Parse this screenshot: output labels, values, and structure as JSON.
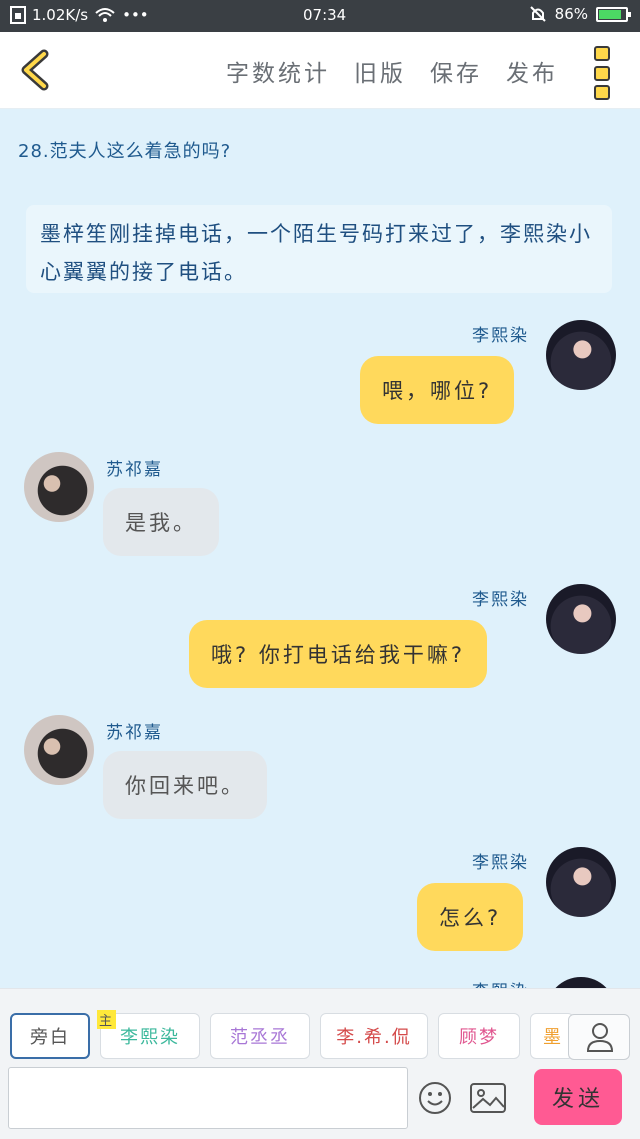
{
  "status_bar": {
    "speed": "1.02K/s",
    "dots": "•••",
    "time": "07:34",
    "battery": "86%",
    "battery_level": 0.86
  },
  "toolbar": {
    "actions": [
      "字数统计",
      "旧版",
      "保存",
      "发布"
    ]
  },
  "chapter_title": "28.范夫人这么着急的吗?",
  "narration": "墨梓笙刚挂掉电话，一个陌生号码打来过了，李熙染小心翼翼的接了电话。",
  "messages": [
    {
      "speaker": "李熙染",
      "text": "喂，哪位?"
    },
    {
      "speaker": "苏祁嘉",
      "text": "是我。"
    },
    {
      "speaker": "李熙染",
      "text": "哦? 你打电话给我干嘛?"
    },
    {
      "speaker": "苏祁嘉",
      "text": "你回来吧。"
    },
    {
      "speaker": "李熙染",
      "text": "怎么?"
    },
    {
      "speaker": "李熙染"
    }
  ],
  "roles": [
    {
      "label": "旁白",
      "color": "#555555"
    },
    {
      "label": "李熙染",
      "color": "#3cb89c",
      "badge": "主"
    },
    {
      "label": "范丞丞",
      "color": "#a877d6"
    },
    {
      "label": "李.希.侃",
      "color": "#d44a4a"
    },
    {
      "label": "顾梦",
      "color": "#e0568f"
    },
    {
      "label": "墨",
      "color": "#f0a030"
    }
  ],
  "input": {
    "value": "",
    "placeholder": ""
  },
  "send_label": "发送",
  "colors": {
    "accent_yellow": "#ffd95c",
    "send_pink": "#ff5a93",
    "bg": "#dff1fb"
  }
}
